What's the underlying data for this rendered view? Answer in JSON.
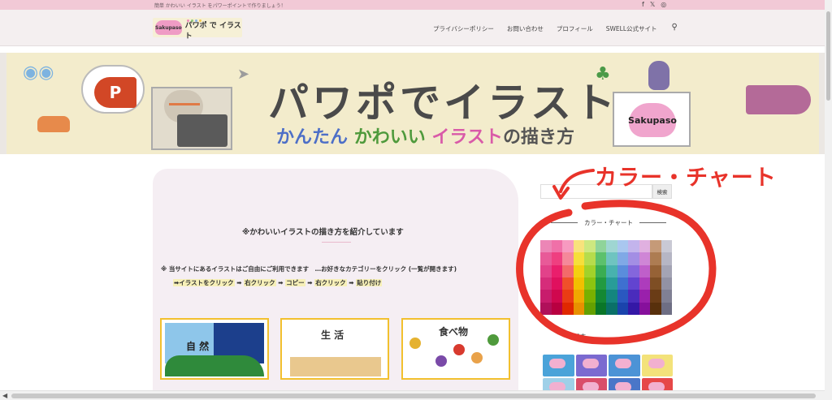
{
  "topbar": {
    "message": "簡単 かわいい イラスト をパワーポイントで作りましょう！",
    "social": [
      {
        "icon": "facebook-icon",
        "glyph": "f"
      },
      {
        "icon": "x-icon",
        "glyph": "𝕏"
      },
      {
        "icon": "instagram-icon",
        "glyph": "◎"
      }
    ]
  },
  "header": {
    "logo_bear_text": "Sakupaso",
    "logo_title": "パワポ で イラスト",
    "nav": [
      "プライバシーポリシー",
      "お問い合わせ",
      "プロフィール",
      "SWELL公式サイト"
    ],
    "search_icon": "search-icon"
  },
  "hero": {
    "title": "パワポでイラスト",
    "subtitle_parts": [
      "かんたん",
      "かわいい",
      "イラスト",
      "の描き方"
    ],
    "powerpoint_letter": "P",
    "badge": "Sakupaso"
  },
  "main": {
    "intro": "※かわいいイラストの描き方を紹介しています",
    "note_line1_prefix": "※ 当サイトにあるイラストはご自由にご利用できます　…お好きなカテゴリーをクリック (一覧が開きます)",
    "note_line2": [
      "➡イラストをクリック",
      " ➡ ",
      "右クリック",
      " ➡ ",
      "コピー",
      " ➡ ",
      "右クリック",
      " ➡ ",
      "貼り付け"
    ],
    "categories": [
      {
        "label": "自 然"
      },
      {
        "label": "生 活"
      },
      {
        "label": "食べ物"
      }
    ]
  },
  "sidebar": {
    "search_button": "検索",
    "color_chart_heading": "カラー・チャート",
    "second_heading": "色見本",
    "swatches": [
      "#ec86b6",
      "#f070a8",
      "#f79ac0",
      "#f8e27c",
      "#cde880",
      "#8fd49a",
      "#9fd6d2",
      "#a9c7ef",
      "#c3b4ec",
      "#e0b0e0",
      "#c59a78",
      "#c9c9d4",
      "#e85a98",
      "#ef3f80",
      "#f5889a",
      "#f6df3a",
      "#b6dc4c",
      "#5cc16c",
      "#6fc4c0",
      "#80a9e6",
      "#a38ee4",
      "#cf86d6",
      "#ad7c52",
      "#b6b6c4",
      "#e2428a",
      "#ea1e6c",
      "#f36a6a",
      "#f4d010",
      "#a1d22a",
      "#3aad52",
      "#48b2ae",
      "#5a8ddc",
      "#8466dc",
      "#bf5fca",
      "#966236",
      "#a4a4b4",
      "#d62c7a",
      "#e0105e",
      "#f0502a",
      "#f2c000",
      "#8cc410",
      "#229a40",
      "#289c98",
      "#3e70d0",
      "#6244d0",
      "#ad3cbc",
      "#7e4e24",
      "#9292a4",
      "#c81c6c",
      "#d0084e",
      "#ea3c14",
      "#f0a800",
      "#78b000",
      "#148832",
      "#14867e",
      "#2a58c0",
      "#4a2cbc",
      "#9a20ac",
      "#6a3c16",
      "#808094",
      "#b0105a",
      "#b80040",
      "#e02800",
      "#e89000",
      "#64a000",
      "#0a7628",
      "#0a7068",
      "#1a44ac",
      "#3418a6",
      "#86109c",
      "#58300c",
      "#6e6e84"
    ],
    "thumb_colors": [
      "#4ba3d9",
      "#7b6ad0",
      "#4c93d6",
      "#f3e27a",
      "#9fd0e8",
      "#d94d6a",
      "#4a76c8",
      "#e64848"
    ]
  },
  "annotation": {
    "label": "カラー・チャート",
    "color": "#e8332a"
  }
}
